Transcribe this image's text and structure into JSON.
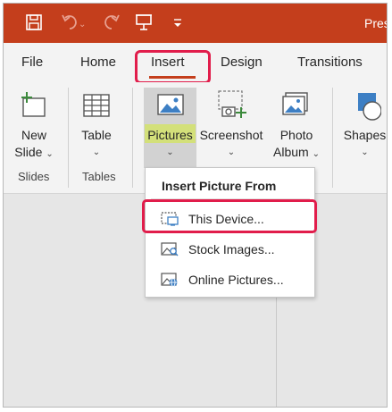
{
  "title_bar": {
    "title": "Pres",
    "background": "#c43e1c"
  },
  "quick_access": [
    {
      "name": "save-icon"
    },
    {
      "name": "undo-icon"
    },
    {
      "name": "redo-icon"
    },
    {
      "name": "presenter-icon"
    },
    {
      "name": "customize-qat-icon"
    }
  ],
  "ribbon_tabs": {
    "file": "File",
    "home": "Home",
    "insert": "Insert",
    "design": "Design",
    "transitions": "Transitions",
    "active": "Insert"
  },
  "ribbon": {
    "new_slide": {
      "line1": "New",
      "line2": "Slide",
      "caret": "⌄"
    },
    "table": {
      "label": "Table",
      "caret": "⌄"
    },
    "pictures": {
      "label": "Pictures",
      "caret": "⌄"
    },
    "screenshot": {
      "label": "Screenshot",
      "caret": "⌄"
    },
    "photo_album": {
      "line1": "Photo",
      "line2": "Album",
      "caret": "⌄"
    },
    "shapes": {
      "label": "Shapes",
      "caret": "⌄"
    },
    "groups": {
      "slides": "Slides",
      "tables": "Tables"
    }
  },
  "dropdown": {
    "header": "Insert Picture From",
    "items": [
      {
        "label": "This Device...",
        "icon": "this-device-icon",
        "highlighted": true
      },
      {
        "label": "Stock Images...",
        "icon": "stock-images-icon"
      },
      {
        "label": "Online Pictures...",
        "icon": "online-pictures-icon"
      }
    ]
  },
  "colors": {
    "accent": "#c43e1c",
    "highlight": "#e11d4b",
    "pictures_label_bg": "#d3e07a"
  }
}
